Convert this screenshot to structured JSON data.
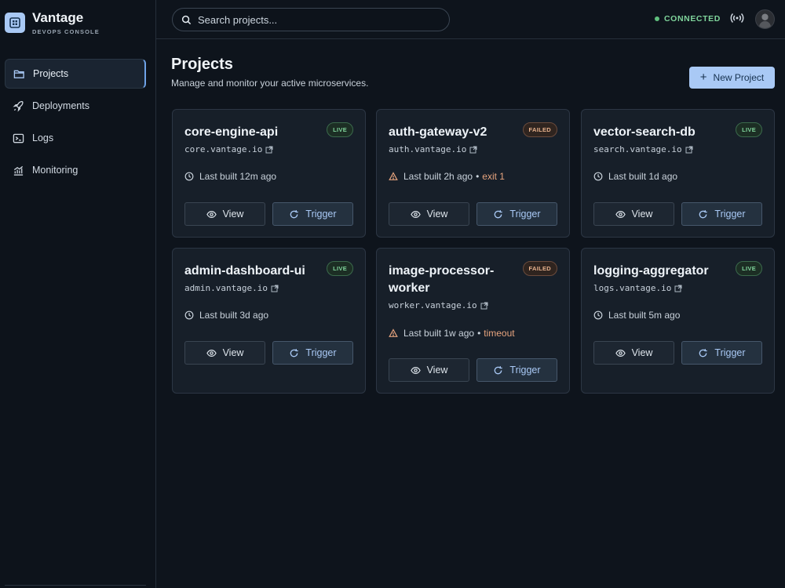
{
  "brand": {
    "name": "Vantage",
    "subtitle": "DEVOPS CONSOLE",
    "logo_icon": "grid-icon"
  },
  "sidebar": {
    "items": [
      {
        "label": "Projects",
        "icon": "folder-icon",
        "active": true
      },
      {
        "label": "Deployments",
        "icon": "rocket-icon",
        "active": false
      },
      {
        "label": "Logs",
        "icon": "terminal-icon",
        "active": false
      },
      {
        "label": "Monitoring",
        "icon": "chart-icon",
        "active": false
      }
    ]
  },
  "header": {
    "search_placeholder": "Search projects...",
    "status": "CONNECTED",
    "status_color": "#7fd49b"
  },
  "main": {
    "title": "Projects",
    "subtitle": "Manage and monitor your active microservices.",
    "new_button": "New Project"
  },
  "colors": {
    "accent": "#a9c9f5",
    "live": "#7fd49b",
    "failed": "#e7b18c",
    "background": "#0e141c",
    "card": "#171f29"
  },
  "projects": [
    {
      "name": "core-engine-api",
      "status": "LIVE",
      "url": "core.vantage.io",
      "build": "Last built 12m ago",
      "error": "",
      "view_label": "View",
      "trigger_label": "Trigger"
    },
    {
      "name": "auth-gateway-v2",
      "status": "FAILED",
      "url": "auth.vantage.io",
      "build": "Last built 2h ago",
      "error": "exit 1",
      "view_label": "View",
      "trigger_label": "Trigger"
    },
    {
      "name": "vector-search-db",
      "status": "LIVE",
      "url": "search.vantage.io",
      "build": "Last built 1d ago",
      "error": "",
      "view_label": "View",
      "trigger_label": "Trigger"
    },
    {
      "name": "admin-dashboard-ui",
      "status": "LIVE",
      "url": "admin.vantage.io",
      "build": "Last built 3d ago",
      "error": "",
      "view_label": "View",
      "trigger_label": "Trigger"
    },
    {
      "name": "image-processor-worker",
      "status": "FAILED",
      "url": "worker.vantage.io",
      "build": "Last built 1w ago",
      "error": "timeout",
      "view_label": "View",
      "trigger_label": "Trigger"
    },
    {
      "name": "logging-aggregator",
      "status": "LIVE",
      "url": "logs.vantage.io",
      "build": "Last built 5m ago",
      "error": "",
      "view_label": "View",
      "trigger_label": "Trigger"
    }
  ]
}
